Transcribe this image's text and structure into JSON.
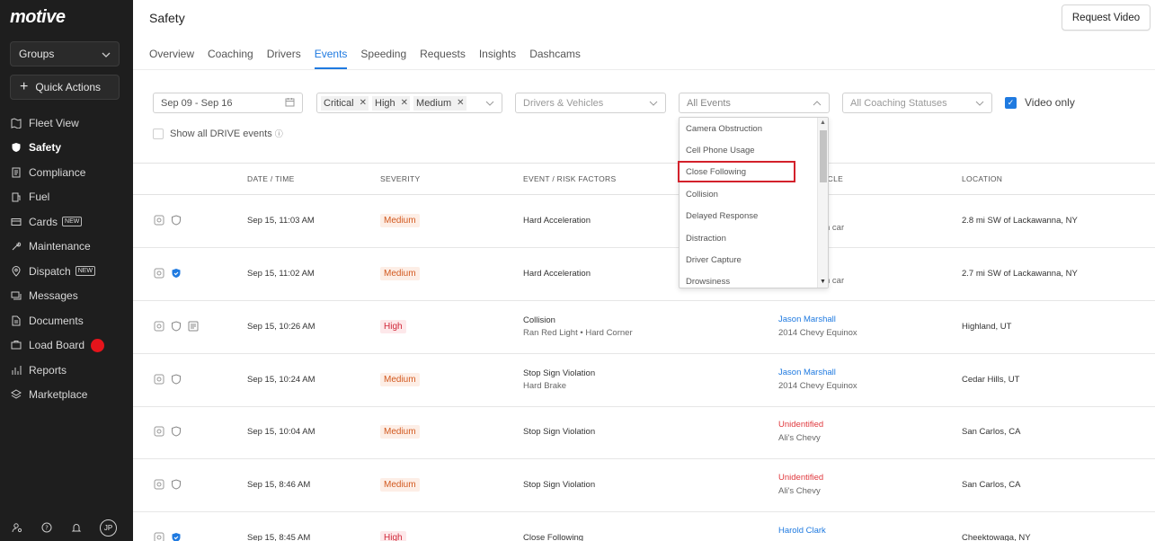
{
  "sidebar": {
    "logo": "motive",
    "groups_label": "Groups",
    "quick_actions_label": "Quick Actions",
    "items": [
      {
        "label": "Fleet View",
        "icon": "map-icon",
        "active": false
      },
      {
        "label": "Safety",
        "icon": "shield-icon",
        "active": true
      },
      {
        "label": "Compliance",
        "icon": "document-icon",
        "active": false
      },
      {
        "label": "Fuel",
        "icon": "fuel-icon",
        "active": false
      },
      {
        "label": "Cards",
        "icon": "card-icon",
        "active": false,
        "badge": "NEW"
      },
      {
        "label": "Maintenance",
        "icon": "wrench-icon",
        "active": false
      },
      {
        "label": "Dispatch",
        "icon": "pin-icon",
        "active": false,
        "badge": "NEW"
      },
      {
        "label": "Messages",
        "icon": "chat-icon",
        "active": false
      },
      {
        "label": "Documents",
        "icon": "file-icon",
        "active": false
      },
      {
        "label": "Load Board",
        "icon": "truck-icon",
        "active": false,
        "dot": true
      },
      {
        "label": "Reports",
        "icon": "chart-icon",
        "active": false
      },
      {
        "label": "Marketplace",
        "icon": "layers-icon",
        "active": false
      }
    ],
    "footer": {
      "avatar_initials": "JP"
    }
  },
  "header": {
    "title": "Safety",
    "request_video_label": "Request Video"
  },
  "tabs": [
    {
      "label": "Overview",
      "active": false
    },
    {
      "label": "Coaching",
      "active": false
    },
    {
      "label": "Drivers",
      "active": false
    },
    {
      "label": "Events",
      "active": true
    },
    {
      "label": "Speeding",
      "active": false
    },
    {
      "label": "Requests",
      "active": false
    },
    {
      "label": "Insights",
      "active": false
    },
    {
      "label": "Dashcams",
      "active": false
    }
  ],
  "filters": {
    "date_range": "Sep 09 - Sep 16",
    "severity_chips": [
      "Critical",
      "High",
      "Medium"
    ],
    "drivers_placeholder": "Drivers & Vehicles",
    "events_placeholder": "All Events",
    "coaching_placeholder": "All Coaching Statuses",
    "video_only_label": "Video only",
    "video_only_checked": true,
    "show_drive_label": "Show all DRIVE events",
    "show_drive_checked": false
  },
  "events_dropdown": {
    "items": [
      "Camera Obstruction",
      "Cell Phone Usage",
      "Close Following",
      "Collision",
      "Delayed Response",
      "Distraction",
      "Driver Capture",
      "Drowsiness"
    ],
    "highlighted": "Close Following"
  },
  "table": {
    "columns": [
      "DATE / TIME",
      "SEVERITY",
      "EVENT / RISK FACTORS",
      "DRIVER / VEHICLE",
      "LOCATION"
    ],
    "visible_vehicle_header_fragment": "ICLE",
    "rows": [
      {
        "datetime": "Sep 15, 11:03 AM",
        "severity": "Medium",
        "event": "Hard Acceleration",
        "risk": "",
        "driver": "",
        "vehicle_fragment": "n car",
        "location": "2.8 mi SW of Lackawanna, NY",
        "shield_blue": false,
        "has_note": false
      },
      {
        "datetime": "Sep 15, 11:02 AM",
        "severity": "Medium",
        "event": "Hard Acceleration",
        "risk": "",
        "driver": "",
        "vehicle_fragment": "n car",
        "location": "2.7 mi SW of Lackawanna, NY",
        "shield_blue": true,
        "has_note": false
      },
      {
        "datetime": "Sep 15, 10:26 AM",
        "severity": "High",
        "event": "Collision",
        "risk": "Ran Red Light • Hard Corner",
        "driver": "Jason Marshall",
        "vehicle": "2014 Chevy Equinox",
        "location": "Highland, UT",
        "shield_blue": false,
        "has_note": true
      },
      {
        "datetime": "Sep 15, 10:24 AM",
        "severity": "Medium",
        "event": "Stop Sign Violation",
        "risk": "Hard Brake",
        "driver": "Jason Marshall",
        "vehicle": "2014 Chevy Equinox",
        "location": "Cedar Hills, UT",
        "shield_blue": false,
        "has_note": false
      },
      {
        "datetime": "Sep 15, 10:04 AM",
        "severity": "Medium",
        "event": "Stop Sign Violation",
        "risk": "",
        "driver": "Unidentified",
        "vehicle": "Ali's Chevy",
        "location": "San Carlos, CA",
        "shield_blue": false,
        "has_note": false,
        "unidentified": true
      },
      {
        "datetime": "Sep 15, 8:46 AM",
        "severity": "Medium",
        "event": "Stop Sign Violation",
        "risk": "",
        "driver": "Unidentified",
        "vehicle": "Ali's Chevy",
        "location": "San Carlos, CA",
        "shield_blue": false,
        "has_note": false,
        "unidentified": true
      },
      {
        "datetime": "Sep 15, 8:45 AM",
        "severity": "High",
        "event": "Close Following",
        "risk": "",
        "driver": "Harold Clark",
        "vehicle": "",
        "location": "Cheektowaga, NY",
        "shield_blue": true,
        "has_note": false
      }
    ]
  },
  "colors": {
    "accent": "#1f7ae0",
    "sidebar_bg": "#1e1e1e",
    "medium": "#d2591f",
    "high": "#d0283a",
    "highlight_border": "#d3212b"
  }
}
